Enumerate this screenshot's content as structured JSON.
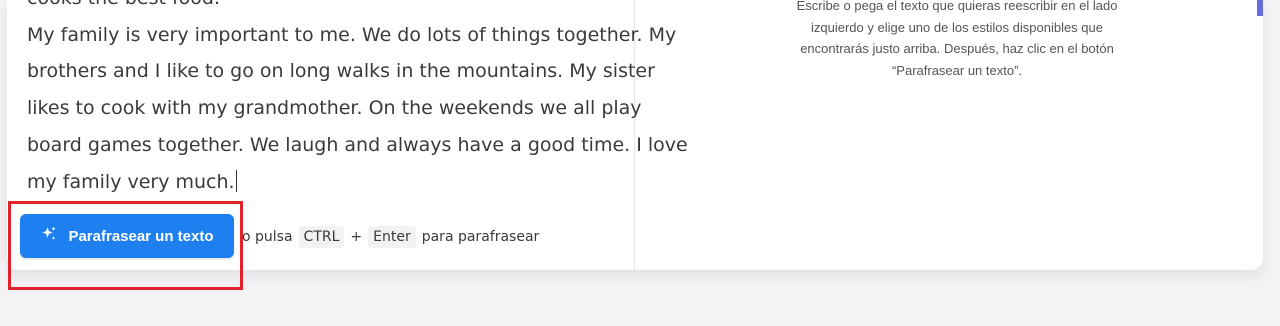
{
  "editor": {
    "lines": [
      "cooks the best food.",
      "My family is very important to me. We do lots of things together. My",
      "brothers and I like to go on long walks in the mountains. My sister",
      "likes to cook with my grandmother. On the weekends we all play",
      "board games together. We laugh and always have a good time. I love",
      "my family very much."
    ]
  },
  "output_panel": {
    "help_lines": [
      "Escribe o pega el texto que quieras reescribir en el lado",
      "izquierdo y elige uno de los estilos disponibles que",
      "encontrarás justo arriba. Después, haz clic en el botón",
      "“Parafrasear un texto”."
    ]
  },
  "actions": {
    "paraphrase_button_label": "Parafrasear un texto",
    "button_icon": "sparkles-icon",
    "shortcut": {
      "prefix": "o pulsa",
      "key1": "CTRL",
      "plus": "+",
      "key2": "Enter",
      "suffix": "para parafrasear"
    }
  },
  "colors": {
    "button": "#1e7ff0",
    "highlight": "#e0232a"
  }
}
